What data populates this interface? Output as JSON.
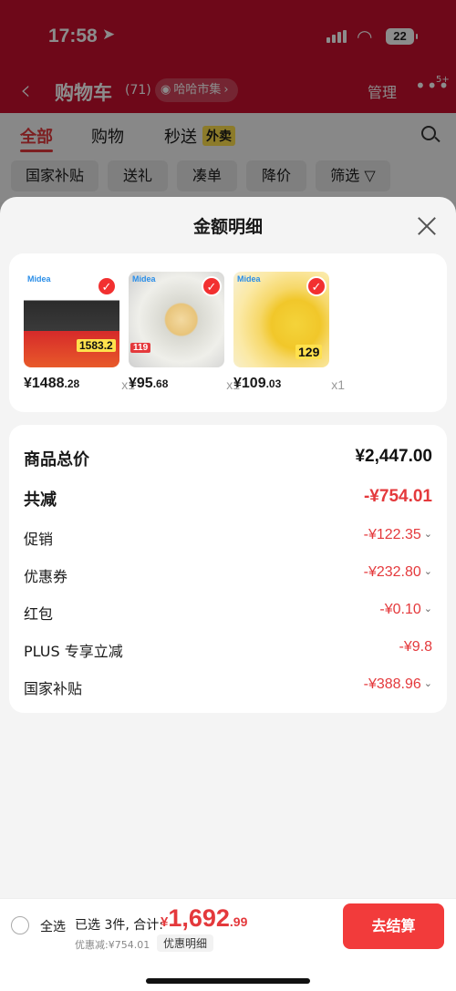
{
  "status_bar": {
    "time": "17:58",
    "battery": "22"
  },
  "nav": {
    "title": "购物车",
    "count": "(71)",
    "market": "哈哈市集",
    "manage": "管理",
    "more_badge": "5+"
  },
  "tabs": {
    "all": "全部",
    "shopping": "购物",
    "seckill": "秒送",
    "waimai": "外卖"
  },
  "chips": [
    "国家补贴",
    "送礼",
    "凑单",
    "降价",
    "筛选"
  ],
  "sheet": {
    "title": "金额明细",
    "products": [
      {
        "brand": "Midea",
        "price_int": "¥1488",
        "price_dec": ".28",
        "qty": "x1",
        "promo": "1583.2"
      },
      {
        "brand": "Midea",
        "price_int": "¥95",
        "price_dec": ".68",
        "qty": "x1",
        "promo": "119"
      },
      {
        "brand": "Midea",
        "price_int": "¥109",
        "price_dec": ".03",
        "qty": "x1",
        "promo": "129"
      }
    ],
    "rows": [
      {
        "label": "商品总价",
        "value": "¥2,447.00"
      },
      {
        "label": "共减",
        "value": "-¥754.01"
      },
      {
        "label": "促销",
        "value": "-¥122.35"
      },
      {
        "label": "优惠券",
        "value": "-¥232.80"
      },
      {
        "label": "红包",
        "value": "-¥0.10"
      },
      {
        "label": "PLUS 专享立减",
        "value": "-¥9.8"
      },
      {
        "label": "国家补贴",
        "value": "-¥388.96"
      }
    ]
  },
  "bottom": {
    "select_all": "全选",
    "selected": "已选 3件, 合计:",
    "currency": "¥",
    "total_int": "1,692",
    "total_dec": ".99",
    "discount": "优惠减:¥754.01",
    "detail": "优惠明细",
    "checkout": "去结算"
  },
  "colors": {
    "accent": "#e4393c",
    "header_red": "#c8102e",
    "checkout": "#f23b3b"
  }
}
